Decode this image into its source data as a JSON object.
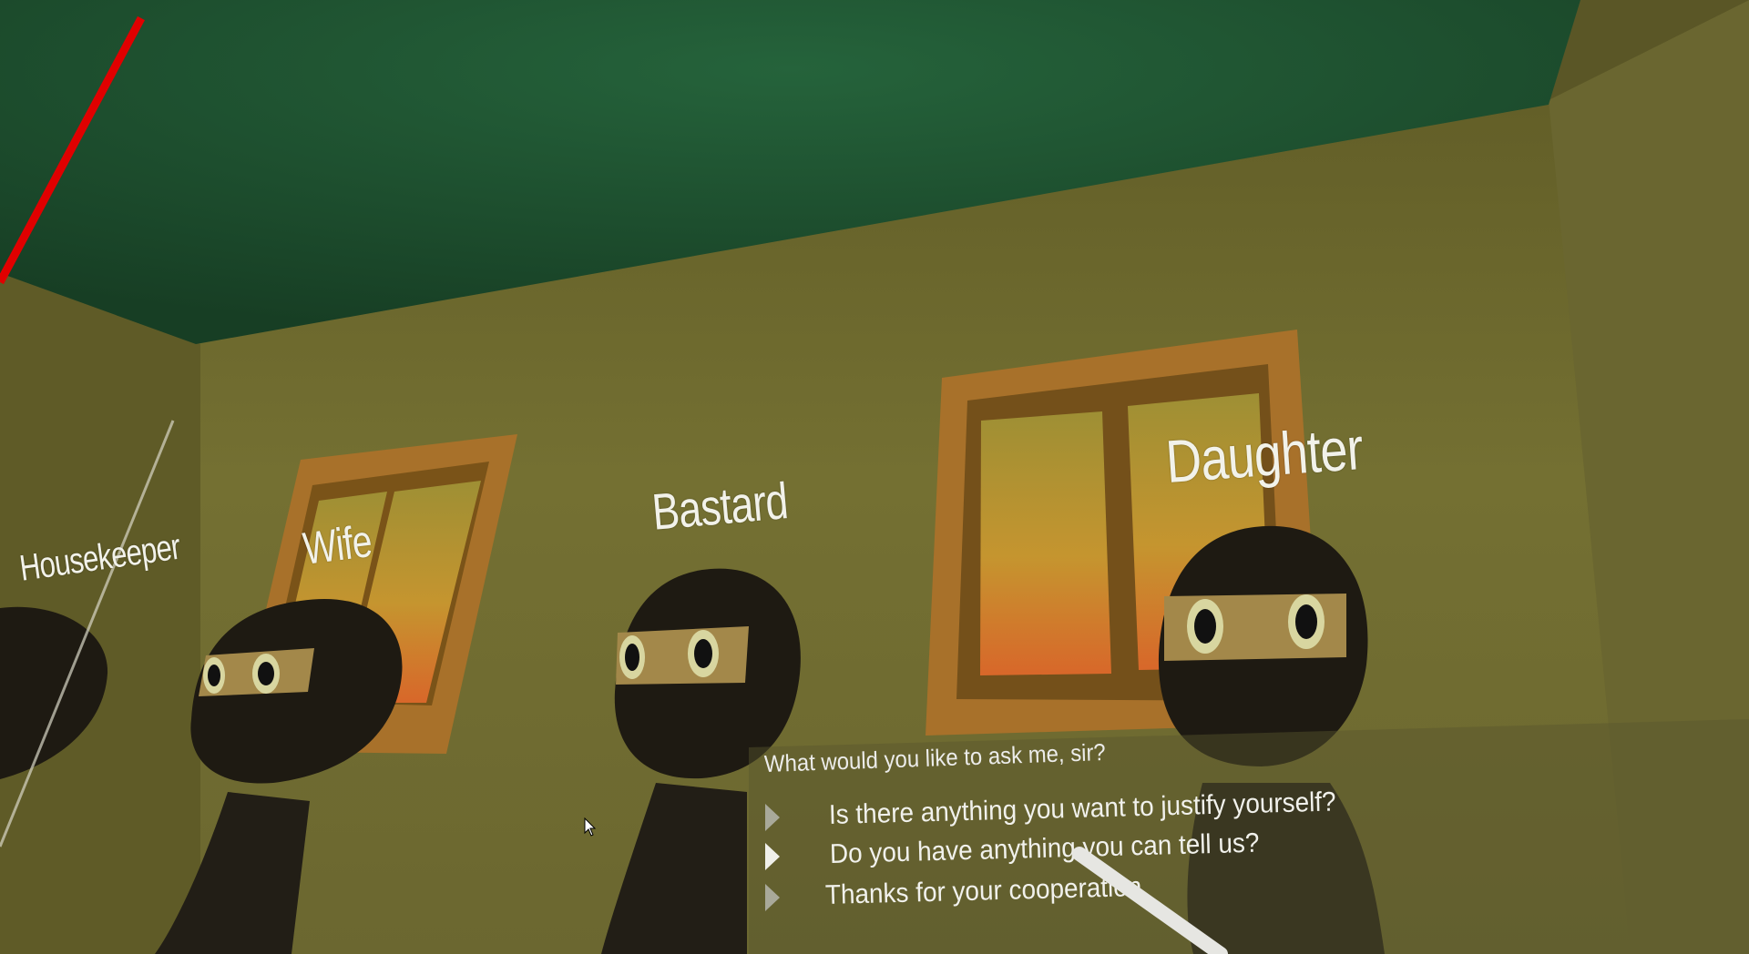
{
  "characters": [
    {
      "name": "Housekeeper"
    },
    {
      "name": "Wife"
    },
    {
      "name": "Bastard"
    },
    {
      "name": "Daughter"
    }
  ],
  "dialogue": {
    "prompt": "What would you like to ask me, sir?",
    "options": [
      {
        "text": "Is there anything you want to justify yourself?"
      },
      {
        "text": "Do you have anything you can tell us?"
      },
      {
        "text": "Thanks for your cooperation"
      }
    ]
  },
  "colors": {
    "ceiling": "#1f5a34",
    "wall": "#6f6a2e",
    "window_frame": "#a9742a",
    "window_glass_top": "#b59a3a",
    "window_glass_bottom": "#d0662a",
    "ninja_body": "#1e1a12",
    "pointer_red": "#e00000",
    "pointer_white": "#e8e8e8"
  }
}
